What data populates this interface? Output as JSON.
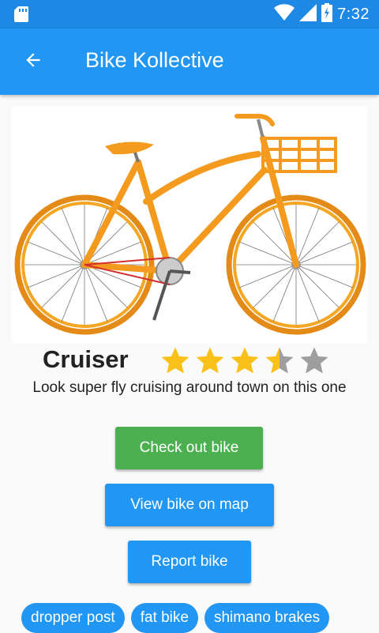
{
  "status_bar": {
    "time": "7:32",
    "icons": [
      "sd-card-icon",
      "wifi-icon",
      "signal-icon",
      "battery-icon"
    ]
  },
  "app_bar": {
    "title": "Bike Kollective",
    "back_icon": "arrow-back-icon"
  },
  "bike": {
    "image_alt": "orange cruiser bicycle with front basket",
    "name": "Cruiser",
    "rating": 3.5,
    "rating_max": 5,
    "description": "Look super fly cruising around town on this one"
  },
  "actions": {
    "checkout": "Check out bike",
    "view_map": "View bike on map",
    "report": "Report bike"
  },
  "tags": [
    "dropper post",
    "fat bike",
    "shimano brakes"
  ],
  "colors": {
    "status_bar": "#1e88e5",
    "app_bar": "#2196f3",
    "checkout_button": "#4caf50",
    "primary_button": "#2196f3",
    "star_filled": "#f9c11a",
    "star_empty": "#9e9e9e",
    "bike_frame": "#f39a1f"
  }
}
